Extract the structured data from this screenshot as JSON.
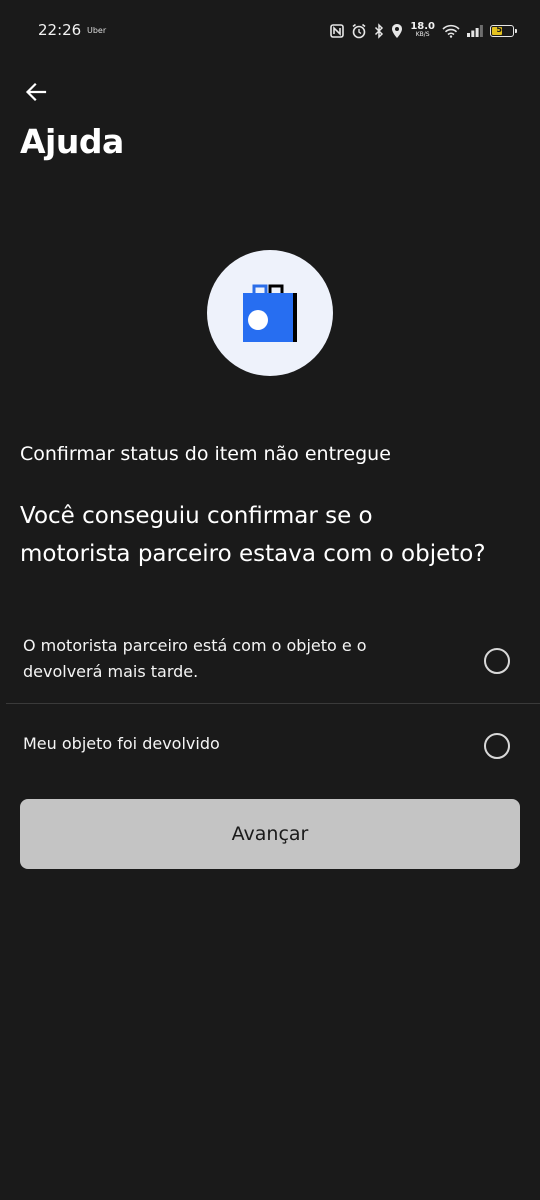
{
  "status_bar": {
    "time": "22:26",
    "app": "Uber",
    "network_speed": "18.0",
    "network_speed_unit": "KB/S",
    "battery": "52",
    "battery_color": "#e3c11f"
  },
  "header": {
    "back_icon": "arrow-left-icon",
    "title": "Ajuda"
  },
  "illustration": {
    "icon": "shopping-bag-icon",
    "colors": {
      "background": "#eef2fb",
      "bag_blue": "#276ef1",
      "bag_black": "#000000"
    }
  },
  "subtitle": "Confirmar status do item não entregue",
  "question": "Você conseguiu confirmar se o motorista parceiro estava com o objeto?",
  "options": [
    {
      "label": "O motorista parceiro está com o objeto e o devolverá mais tarde.",
      "selected": false
    },
    {
      "label": "Meu objeto foi devolvido",
      "selected": false
    }
  ],
  "next_button": {
    "label": "Avançar",
    "enabled": false
  }
}
